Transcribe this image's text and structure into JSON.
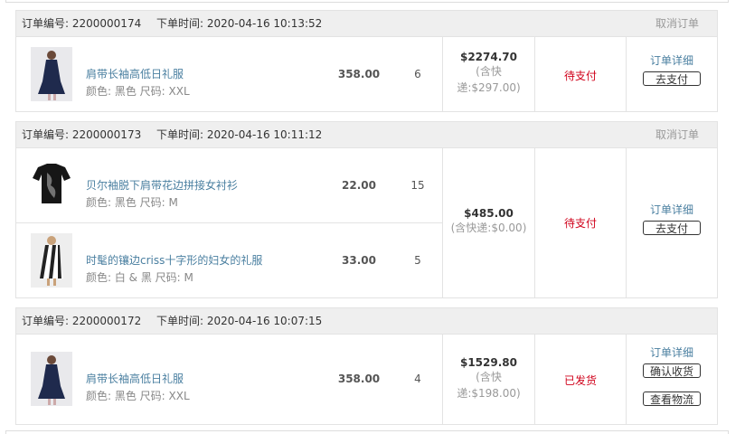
{
  "labels": {
    "order_no": "订单编号: ",
    "order_time": "下单时间: ",
    "cancel": "取消订单",
    "detail": "订单详细",
    "pay": "去支付",
    "confirm": "确认收货",
    "logistics": "查看物流"
  },
  "orders": [
    {
      "order_no": "2200000174",
      "order_time": "2020-04-16 10:13:52",
      "total": "$2274.70",
      "shipping_line1": "(含快",
      "shipping_line2": "递:$297.00)",
      "status": "待支付",
      "items": [
        {
          "name": "肩带长袖高低日礼服",
          "attrs": "颜色: 黑色   尺码: XXL",
          "price": "358.00",
          "qty": "6"
        }
      ]
    },
    {
      "order_no": "2200000173",
      "order_time": "2020-04-16 10:11:12",
      "total": "$485.00",
      "shipping_line1": "(含快递:$0.00)",
      "status": "待支付",
      "items": [
        {
          "name": "贝尔袖脱下肩带花边拼接女衬衫",
          "attrs": "颜色: 黑色   尺码: M",
          "price": "22.00",
          "qty": "15"
        },
        {
          "name": "时髦的镶边criss十字形的妇女的礼服",
          "attrs": "颜色: 白 & 黑   尺码: M",
          "price": "33.00",
          "qty": "5"
        }
      ]
    },
    {
      "order_no": "2200000172",
      "order_time": "2020-04-16 10:07:15",
      "total": "$1529.80",
      "shipping_line1": "(含快",
      "shipping_line2": "递:$198.00)",
      "status": "已发货",
      "items": [
        {
          "name": "肩带长袖高低日礼服",
          "attrs": "颜色: 黑色   尺码: XXL",
          "price": "358.00",
          "qty": "4"
        }
      ]
    }
  ]
}
